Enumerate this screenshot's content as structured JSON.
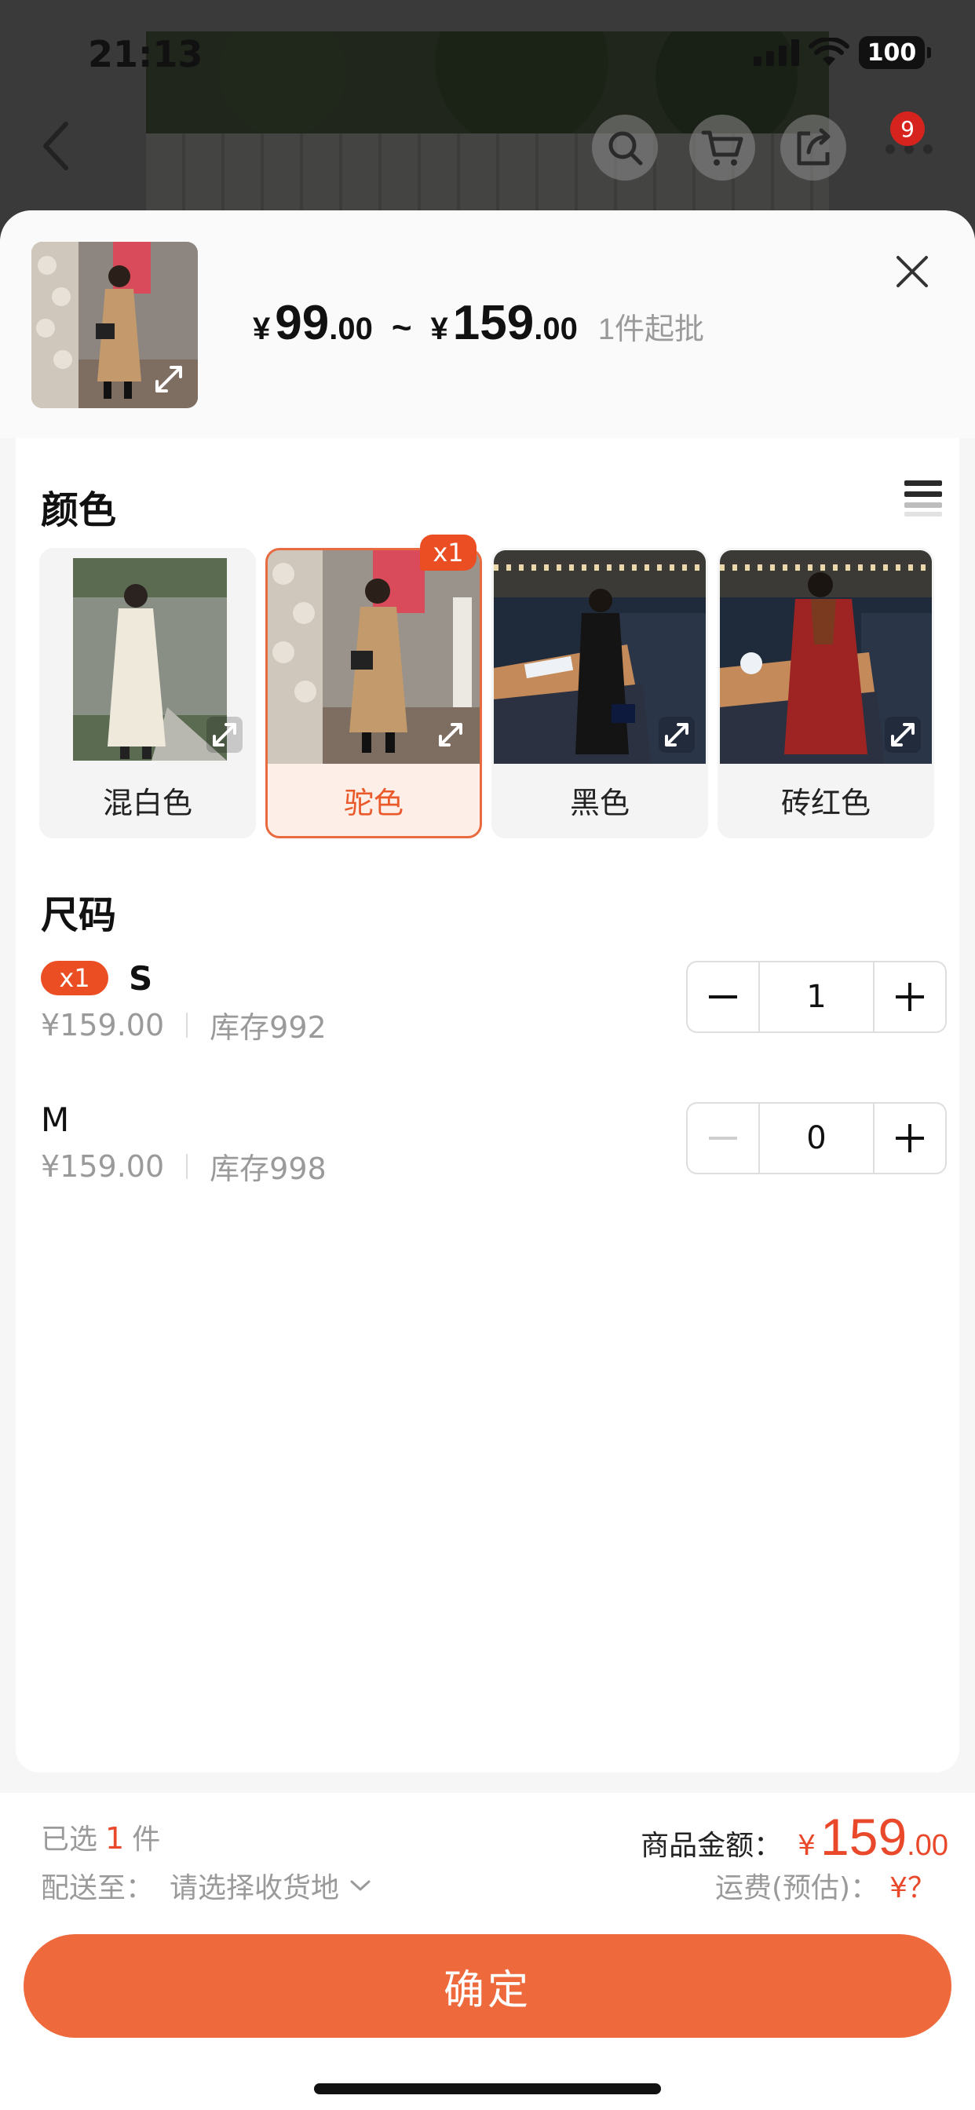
{
  "status_bar": {
    "time": "21:13",
    "battery": "100"
  },
  "nav": {
    "cart_badge": "9"
  },
  "header": {
    "price_min_yen": "¥",
    "price_min_int": "99",
    "price_min_dec": ".00",
    "price_separator": "~",
    "price_max_yen": "¥",
    "price_max_int": "159",
    "price_max_dec": ".00",
    "moq": "1件起批"
  },
  "color_section": {
    "title": "颜色",
    "items": [
      {
        "label": "混白色",
        "selected": false,
        "swatch": "#efe9dc"
      },
      {
        "label": "驼色",
        "selected": true,
        "swatch": "#c39a6b",
        "qty_tag": "x1"
      },
      {
        "label": "黑色",
        "selected": false,
        "swatch": "#1c1c1c"
      },
      {
        "label": "砖红色",
        "selected": false,
        "swatch": "#9e2424"
      }
    ]
  },
  "size_section": {
    "title": "尺码",
    "rows": [
      {
        "tag": "x1",
        "name": "S",
        "price": "¥159.00",
        "stock": "库存992",
        "qty": "1"
      },
      {
        "name": "M",
        "price": "¥159.00",
        "stock": "库存998",
        "qty": "0"
      }
    ]
  },
  "footer": {
    "selected_prefix": "已选",
    "selected_count": "1",
    "selected_suffix": "件",
    "ship_label": "配送至：",
    "ship_value": "请选择收货地",
    "total_label": "商品金额：",
    "total_yen": "¥",
    "total_int": "159",
    "total_dec": ".00",
    "freight_label": "运费(预估)：",
    "freight_value": "¥？",
    "confirm_label": "确定"
  },
  "colors": {
    "accent": "#ee6a3d",
    "badge": "#eb4e22",
    "price_red": "#e9492a"
  }
}
